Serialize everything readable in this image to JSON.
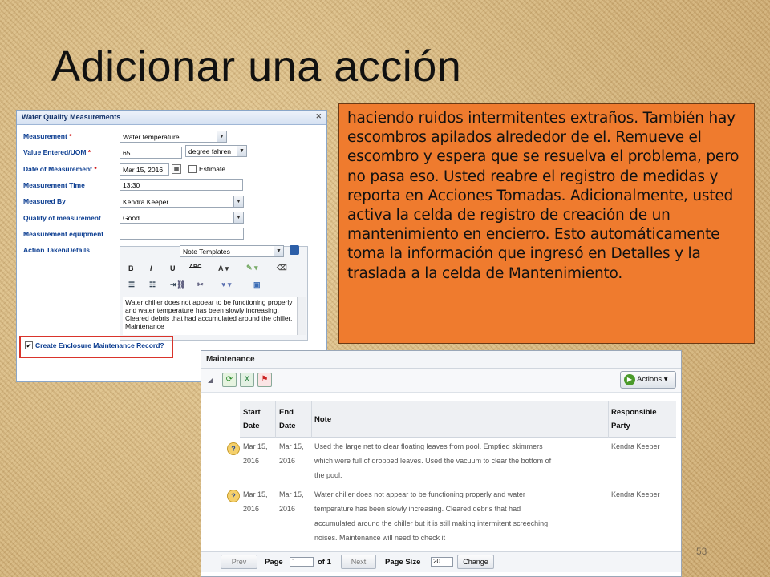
{
  "slide": {
    "title": "Adicionar una acción",
    "page_number": "53"
  },
  "water_quality": {
    "header": "Water Quality Measurements",
    "measurement_label": "Measurement",
    "measurement_value": "Water temperature",
    "value_label": "Value Entered/UOM",
    "value": "65",
    "uom": "degree fahren",
    "date_label": "Date of Measurement",
    "date_value": "Mar 15, 2016",
    "estimate_label": "Estimate",
    "time_label": "Measurement Time",
    "time_value": "13:30",
    "measured_by_label": "Measured By",
    "measured_by_value": "Kendra Keeper",
    "quality_label": "Quality of measurement",
    "quality_value": "Good",
    "equipment_label": "Measurement equipment",
    "equipment_value": "",
    "action_label": "Action Taken/Details",
    "note_templates": "Note Templates",
    "editor_text": "Water chiller does not appear to be functioning properly and water temperature has been slowly increasing. Cleared debris that had accumulated around the chiller. Maintenance",
    "create_record_label": "Create Enclosure Maintenance Record?",
    "toolbar_row1": [
      "B",
      "I",
      "U",
      "ABC",
      "A",
      "▾",
      "✎",
      "▾",
      "⌫"
    ],
    "toolbar_row2": [
      "☰",
      "☷",
      "⇥",
      "⛓",
      "✂",
      "♥",
      "▾",
      "▣"
    ]
  },
  "orange_text": "haciendo ruidos intermitentes extraños. También hay escombros apilados alrededor de el.  Remueve el escombro y espera que se resuelva el problema, pero no pasa eso. Usted reabre el registro de medidas y reporta en Acciones Tomadas. Adicionalmente, usted activa la celda de registro de creación de un mantenimiento en encierro. Esto automáticamente toma la información que ingresó en Detalles y la traslada a la celda de Mantenimiento.",
  "maintenance": {
    "header": "Maintenance",
    "actions_label": "Actions ▾",
    "columns": {
      "start": [
        "Start",
        "Date"
      ],
      "end": [
        "End",
        "Date"
      ],
      "note": "Note",
      "party": [
        "Responsible",
        "Party"
      ]
    },
    "rows": [
      {
        "start": [
          "Mar 15,",
          "2016"
        ],
        "end": [
          "Mar 15,",
          "2016"
        ],
        "note": [
          "Used the large net to clear floating leaves from pool. Emptied skimmers",
          "which were full of dropped leaves. Used the vacuum to clear the bottom of",
          "the pool."
        ],
        "party": "Kendra Keeper"
      },
      {
        "start": [
          "Mar 15,",
          "2016"
        ],
        "end": [
          "Mar 15,",
          "2016"
        ],
        "note": [
          "Water chiller does not appear to be functioning properly and water",
          "temperature has been slowly increasing. Cleared debris that had",
          "accumulated around the chiller but it is still making intermitent screeching",
          "noises. Maintenance will need to check it"
        ],
        "party": "Kendra Keeper"
      }
    ],
    "pager": {
      "prev": "Prev",
      "page_label": "Page",
      "page_value": "1",
      "of_label": "of 1",
      "next": "Next",
      "page_size_label": "Page Size",
      "page_size_value": "20",
      "change": "Change"
    }
  }
}
